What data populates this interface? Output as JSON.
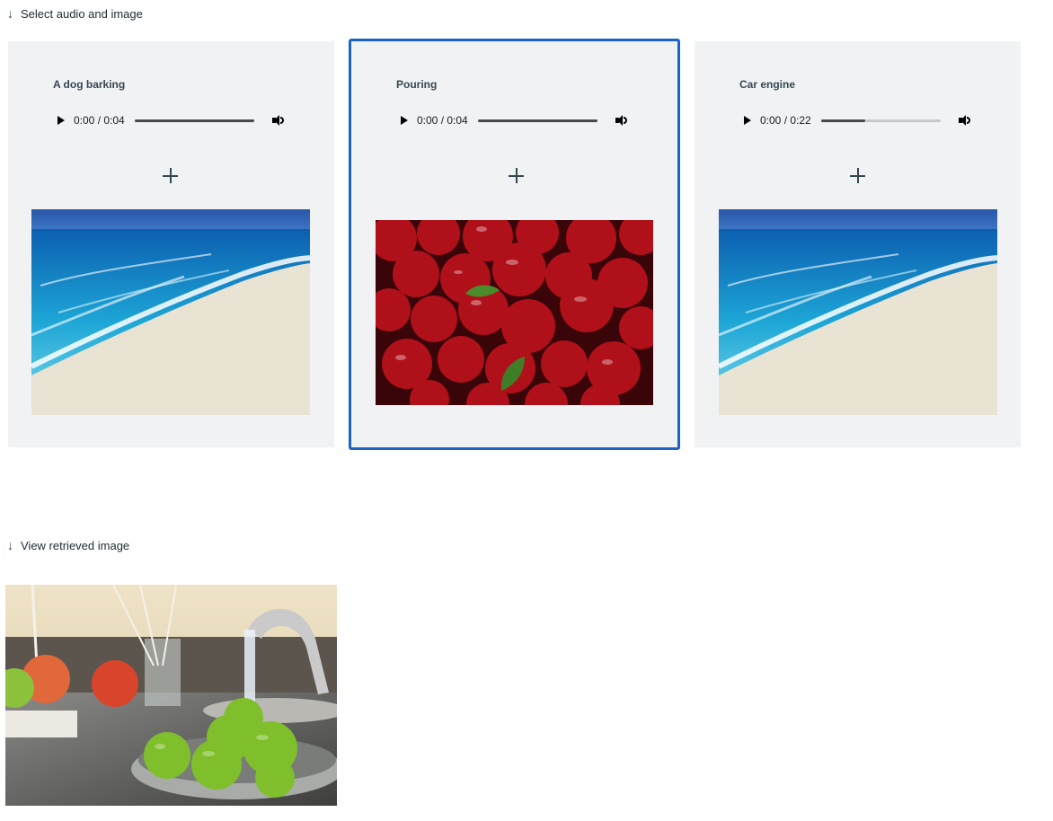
{
  "select_section": {
    "arrow": "↓",
    "label": "Select audio and image"
  },
  "cards": [
    {
      "title": "A dog barking",
      "time": "0:00 / 0:04",
      "progress": 1.0,
      "image_alt": "Beach with turquoise water"
    },
    {
      "title": "Pouring",
      "time": "0:00 / 0:04",
      "progress": 1.0,
      "image_alt": "Pile of red apples"
    },
    {
      "title": "Car engine",
      "time": "0:00 / 0:22",
      "progress": 0.37,
      "image_alt": "Beach with turquoise water"
    }
  ],
  "result_section": {
    "arrow": "↓",
    "label": "View retrieved image",
    "image_alt": "Green apples in a colander under a faucet"
  },
  "colors": {
    "selected_border": "#1b63c6",
    "card_bg": "#f1f2f4"
  }
}
